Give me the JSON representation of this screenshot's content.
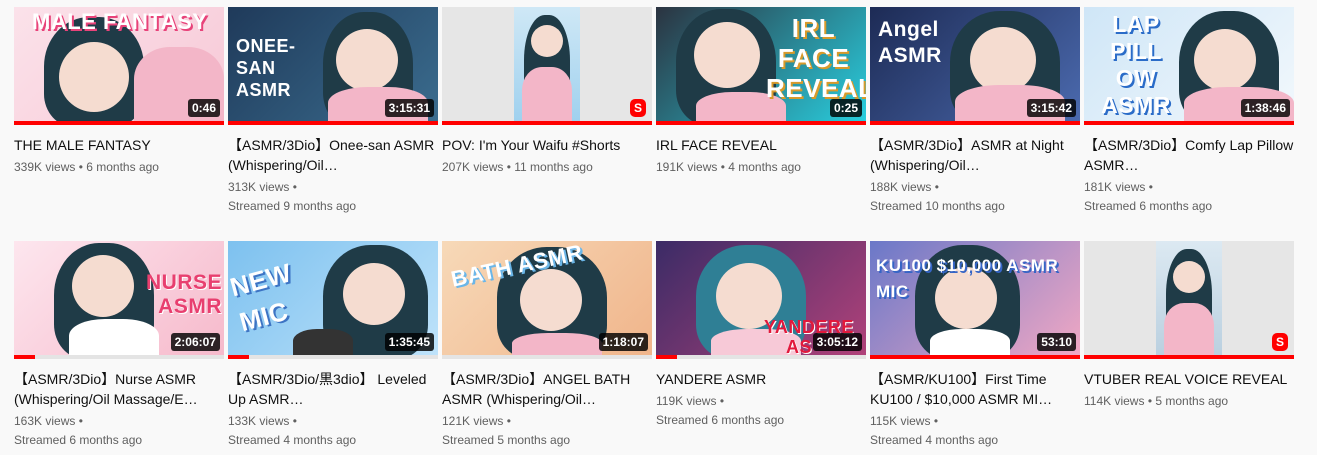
{
  "videos": [
    {
      "title": "THE MALE FANTASY",
      "duration": "0:46",
      "views": "339K views",
      "age": "6 months ago",
      "overlay": "MALE FANTASY",
      "progress": 1.0
    },
    {
      "title": "【ASMR/3Dio】Onee-san ASMR (Whispering/Oil…",
      "duration": "3:15:31",
      "views": "313K views",
      "age": "Streamed 9 months ago",
      "overlay": "ONEE- SAN ASMR",
      "progress": 1.0
    },
    {
      "title": "POV: I'm Your Waifu #Shorts",
      "duration": "",
      "views": "207K views",
      "age": "11 months ago",
      "overlay": "",
      "progress": 1.0,
      "short": true
    },
    {
      "title": "IRL FACE REVEAL",
      "duration": "0:25",
      "views": "191K views",
      "age": "4 months ago",
      "overlay": "IRL FACE REVEAL",
      "progress": 1.0
    },
    {
      "title": "【ASMR/3Dio】ASMR at Night (Whispering/Oil…",
      "duration": "3:15:42",
      "views": "188K views",
      "age": "Streamed 10 months ago",
      "overlay": "Angel ASMR",
      "progress": 1.0
    },
    {
      "title": "【ASMR/3Dio】Comfy Lap Pillow ASMR…",
      "duration": "1:38:46",
      "views": "181K views",
      "age": "Streamed 6 months ago",
      "overlay": "LAP PILL OW ASMR",
      "progress": 1.0
    },
    {
      "title": "【ASMR/3Dio】Nurse ASMR (Whispering/Oil Massage/E…",
      "duration": "2:06:07",
      "views": "163K views",
      "age": "Streamed 6 months ago",
      "overlay": "NURSE ASMR",
      "progress": 0.1
    },
    {
      "title": "【ASMR/3Dio/黒3dio】 Leveled Up ASMR…",
      "duration": "1:35:45",
      "views": "133K views",
      "age": "Streamed 4 months ago",
      "overlay": "NEW MIC",
      "progress": 0.1
    },
    {
      "title": "【ASMR/3Dio】ANGEL BATH ASMR (Whispering/Oil…",
      "duration": "1:18:07",
      "views": "121K views",
      "age": "Streamed 5 months ago",
      "overlay": "BATH ASMR",
      "progress": 0.0
    },
    {
      "title": "YANDERE ASMR",
      "duration": "3:05:12",
      "views": "119K views",
      "age": "Streamed 6 months ago",
      "overlay": "YANDERE AS",
      "progress": 0.1
    },
    {
      "title": "【ASMR/KU100】First Time KU100 / $10,000 ASMR MI…",
      "duration": "53:10",
      "views": "115K views",
      "age": "Streamed 4 months ago",
      "overlay": "KU100 $10,000 ASMR MIC",
      "progress": 1.0
    },
    {
      "title": "VTUBER REAL VOICE REVEAL",
      "duration": "",
      "views": "114K views",
      "age": "5 months ago",
      "overlay": "",
      "progress": 1.0,
      "short": true
    }
  ],
  "colors": {
    "accent": "#ff0000",
    "meta": "#606060",
    "background": "#f9f9f9"
  },
  "icons": {
    "short": "shorts-icon"
  }
}
